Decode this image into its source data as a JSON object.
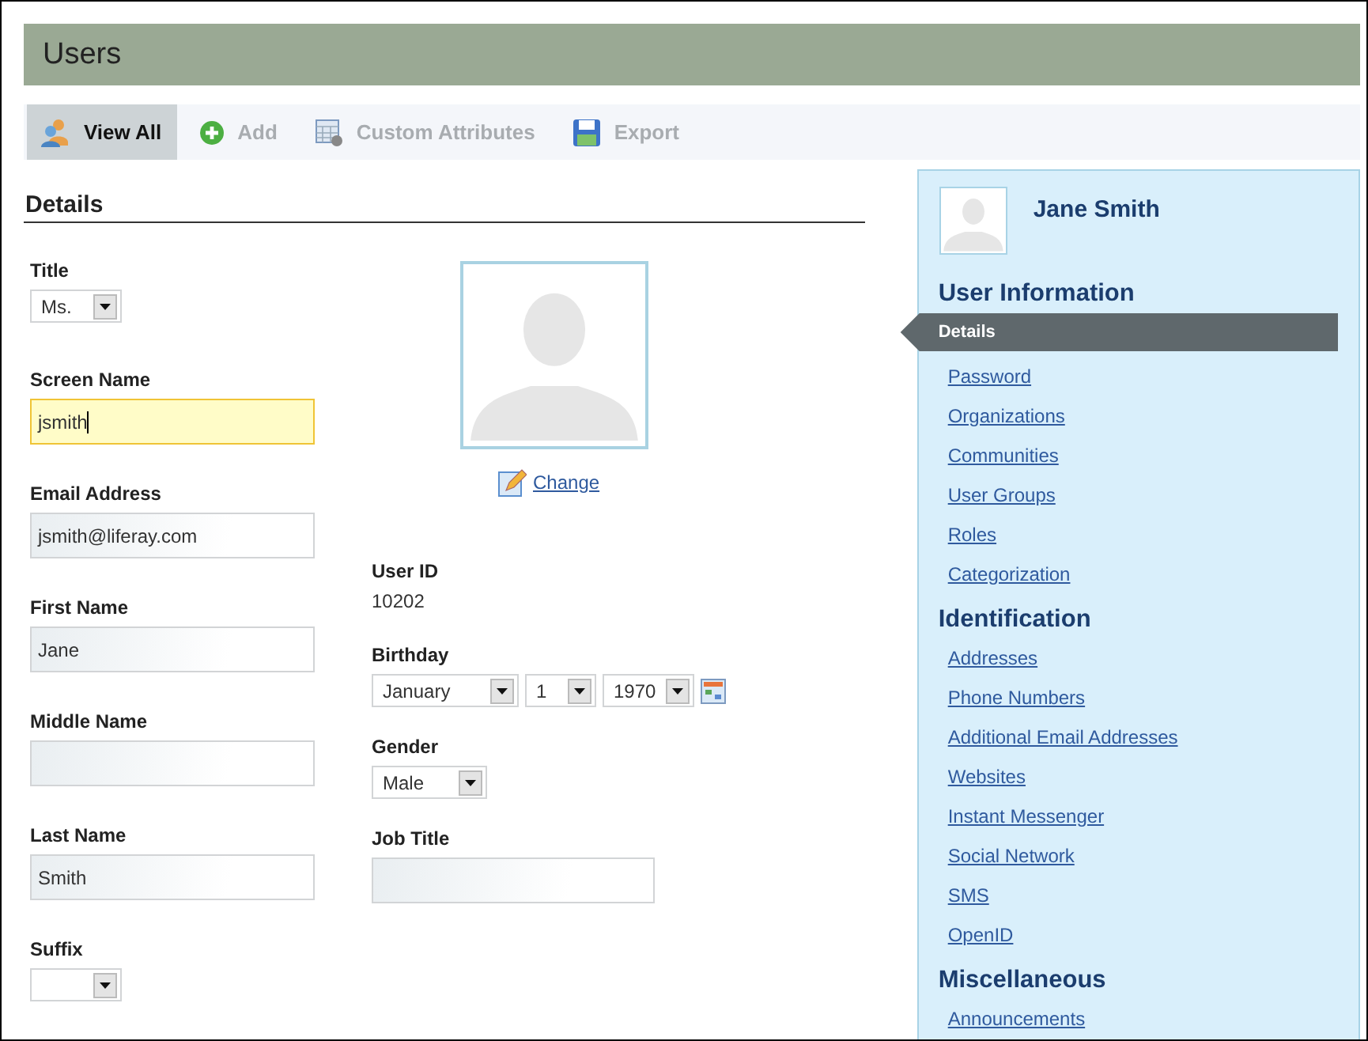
{
  "header": {
    "title": "Users"
  },
  "toolbar": [
    {
      "label": "View All",
      "selected": true
    },
    {
      "label": "Add",
      "selected": false
    },
    {
      "label": "Custom Attributes",
      "selected": false
    },
    {
      "label": "Export",
      "selected": false
    }
  ],
  "section_title": "Details",
  "left_fields": [
    {
      "label": "Title",
      "kind": "select",
      "value": "Ms."
    },
    {
      "label": "Screen Name",
      "kind": "text",
      "value": "jsmith",
      "focused": true
    },
    {
      "label": "Email Address",
      "kind": "text",
      "value": "jsmith@liferay.com",
      "focused": false
    },
    {
      "label": "First Name",
      "kind": "text",
      "value": "Jane",
      "focused": false
    },
    {
      "label": "Middle Name",
      "kind": "text",
      "focused": false
    },
    {
      "label": "Last Name",
      "kind": "text",
      "value": "Smith",
      "focused": false
    },
    {
      "label": "Suffix",
      "kind": "select"
    }
  ],
  "portrait": {
    "change_link": "Change"
  },
  "user_id": {
    "label": "User ID",
    "value": "10202"
  },
  "birthday": {
    "label": "Birthday",
    "month": "January",
    "day": "1",
    "year": "1970"
  },
  "gender": {
    "label": "Gender",
    "value": "Male"
  },
  "job_title": {
    "label": "Job Title"
  },
  "sidebar": {
    "name": "Jane Smith",
    "sections": [
      {
        "title": "User Information",
        "items": [
          {
            "label": "Details",
            "selected": true
          },
          {
            "label": "Password",
            "selected": false
          },
          {
            "label": "Organizations",
            "selected": false
          },
          {
            "label": "Communities",
            "selected": false
          },
          {
            "label": "User Groups",
            "selected": false
          },
          {
            "label": "Roles",
            "selected": false
          },
          {
            "label": "Categorization",
            "selected": false
          }
        ]
      },
      {
        "title": "Identification",
        "items": [
          {
            "label": "Addresses",
            "selected": false
          },
          {
            "label": "Phone Numbers",
            "selected": false
          },
          {
            "label": "Additional Email Addresses",
            "selected": false
          },
          {
            "label": "Websites",
            "selected": false
          },
          {
            "label": "Instant Messenger",
            "selected": false
          },
          {
            "label": "Social Network",
            "selected": false
          },
          {
            "label": "SMS",
            "selected": false
          },
          {
            "label": "OpenID",
            "selected": false
          }
        ]
      },
      {
        "title": "Miscellaneous",
        "items": [
          {
            "label": "Announcements",
            "selected": false
          }
        ]
      }
    ]
  }
}
